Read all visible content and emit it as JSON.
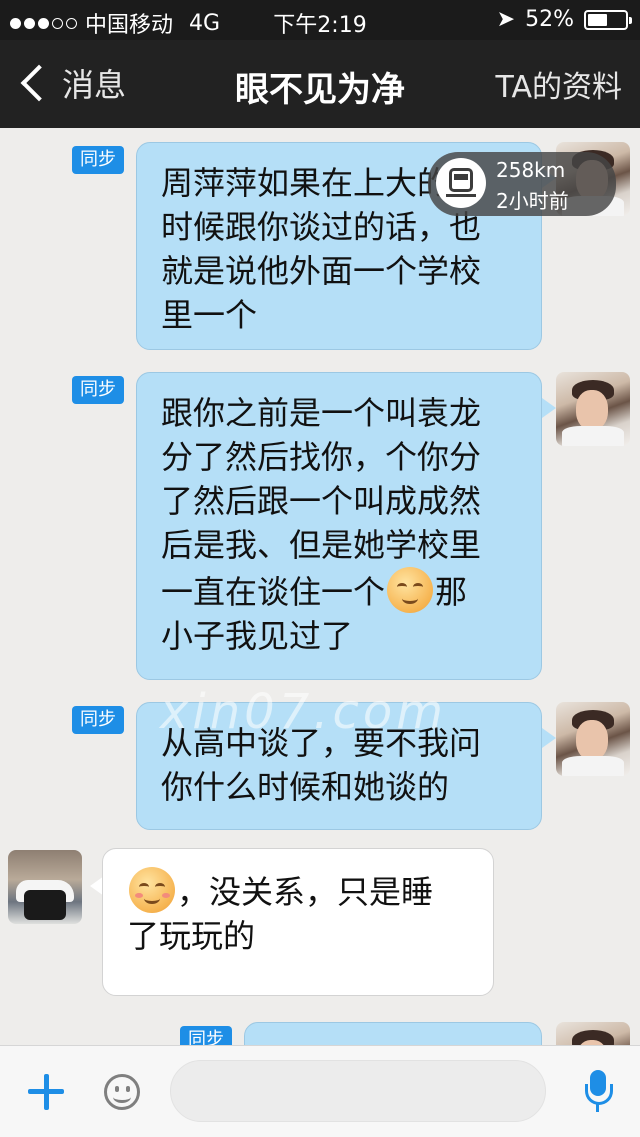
{
  "status_bar": {
    "carrier": "中国移动",
    "network": "4G",
    "time": "下午2:19",
    "battery": "52%",
    "battery_level": 0.52,
    "signal_bars": 3,
    "signal_total": 5
  },
  "nav": {
    "back_label": "消息",
    "title": "眼不见为净",
    "right_label": "TA的资料"
  },
  "location_popup": {
    "distance": "258km",
    "time_ago": "2小时前",
    "icon": "train-icon"
  },
  "watermark": "xin07.com",
  "messages": [
    {
      "sender": "me",
      "badge": "同步",
      "text": "周萍萍如果在上大的\n时候跟你谈过的话，也\n就是说他外面一个学校\n里一个"
    },
    {
      "sender": "me",
      "badge": "同步",
      "text_before": "跟你之前是一个叫袁龙\n分了然后找你，个你分\n了然后跟一个叫成成然\n后是我、但是她学校里\n一直在谈住一个",
      "emoji": "awkward-emoji",
      "text_after": "那\n小子我见过了"
    },
    {
      "sender": "me",
      "badge": "同步",
      "text": "从高中谈了，要不我问\n你什么时候和她谈的"
    },
    {
      "sender": "them",
      "emoji": "smile-blush-emoji",
      "text": "，没关系，只是睡\n了玩玩的"
    },
    {
      "sender": "me",
      "badge": "同步",
      "text": ""
    }
  ],
  "input_bar": {
    "placeholder": "",
    "icons": [
      "plus-icon",
      "emoji-icon",
      "microphone-icon"
    ]
  },
  "colors": {
    "accent": "#1e8ee6",
    "my_bubble": "#b5dff7",
    "their_bubble": "#ffffff",
    "nav_background": "#222222"
  }
}
